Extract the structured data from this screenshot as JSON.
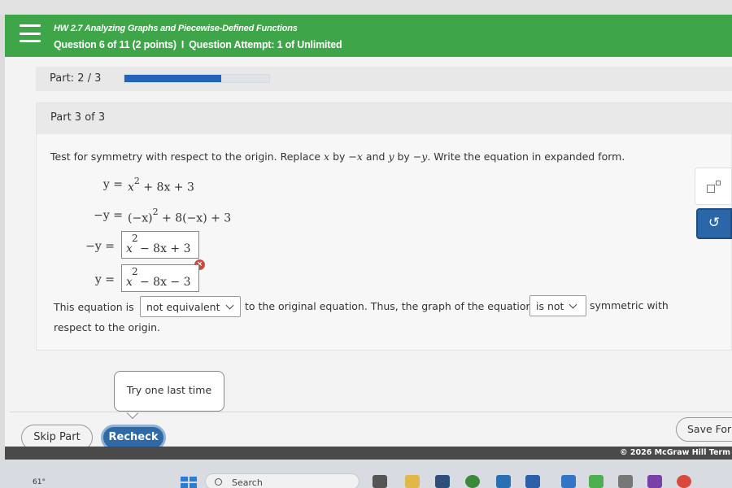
{
  "header": {
    "assignment_title": "HW 2.7 Analyzing Graphs and Piecewise-Defined Functions",
    "question_label": "Question 6 of 11 (2 points)",
    "separator": "I",
    "attempt_label": "Question Attempt: 1 of Unlimited"
  },
  "part_progress": {
    "label_prefix": "Part:",
    "label_value": "2 / 3",
    "fraction_filled": 0.667,
    "color": "#2364b8"
  },
  "section": {
    "title": "Part 3 of 3",
    "instructions": {
      "t1": "Test for symmetry with respect to the origin. Replace",
      "v1": "x",
      "t2": "by",
      "v2": "−x",
      "t3": "and",
      "v3": "y",
      "t4": "by",
      "v4": "−y",
      "t5": ". Write the equation in expanded form."
    },
    "equations": {
      "line1_lhs": "y =",
      "line1_rhs_a": "x",
      "line1_rhs_exp": "2",
      "line1_rhs_b": "+ 8x + 3",
      "line2_lhs": "−y =",
      "line2_rhs_a": "(−x)",
      "line2_rhs_exp": "2",
      "line2_rhs_b": "+ 8(−x) + 3",
      "line3_lhs": "−y =",
      "line4_lhs": "y ="
    },
    "answers": {
      "answer1_exp": "2",
      "answer1_base": "x",
      "answer1_rest": "−  8x  +  3",
      "answer2_exp": "2",
      "answer2_base": "x",
      "answer2_rest": "−  8x  −  3",
      "error_mark": "×"
    },
    "conclusion": {
      "t1": "This equation is",
      "dropdown1_value": "not equivalent",
      "t2": "to the original equation. Thus, the graph of the equation",
      "dropdown2_value": "is not",
      "t3": "symmetric with",
      "t4": "respect to the origin."
    }
  },
  "tools": {
    "undo_glyph": "↺"
  },
  "tooltip": {
    "text": "Try one last time"
  },
  "footer": {
    "skip_label": "Skip Part",
    "recheck_label": "Recheck",
    "save_label": "Save For",
    "copyright": "© 2026 McGraw Hill   Term"
  },
  "taskbar": {
    "temperature": "61°",
    "search_placeholder": "Search"
  },
  "colors": {
    "header_green": "#3ea549",
    "accent_blue": "#2f6aa6",
    "error_red": "#c84b43"
  }
}
